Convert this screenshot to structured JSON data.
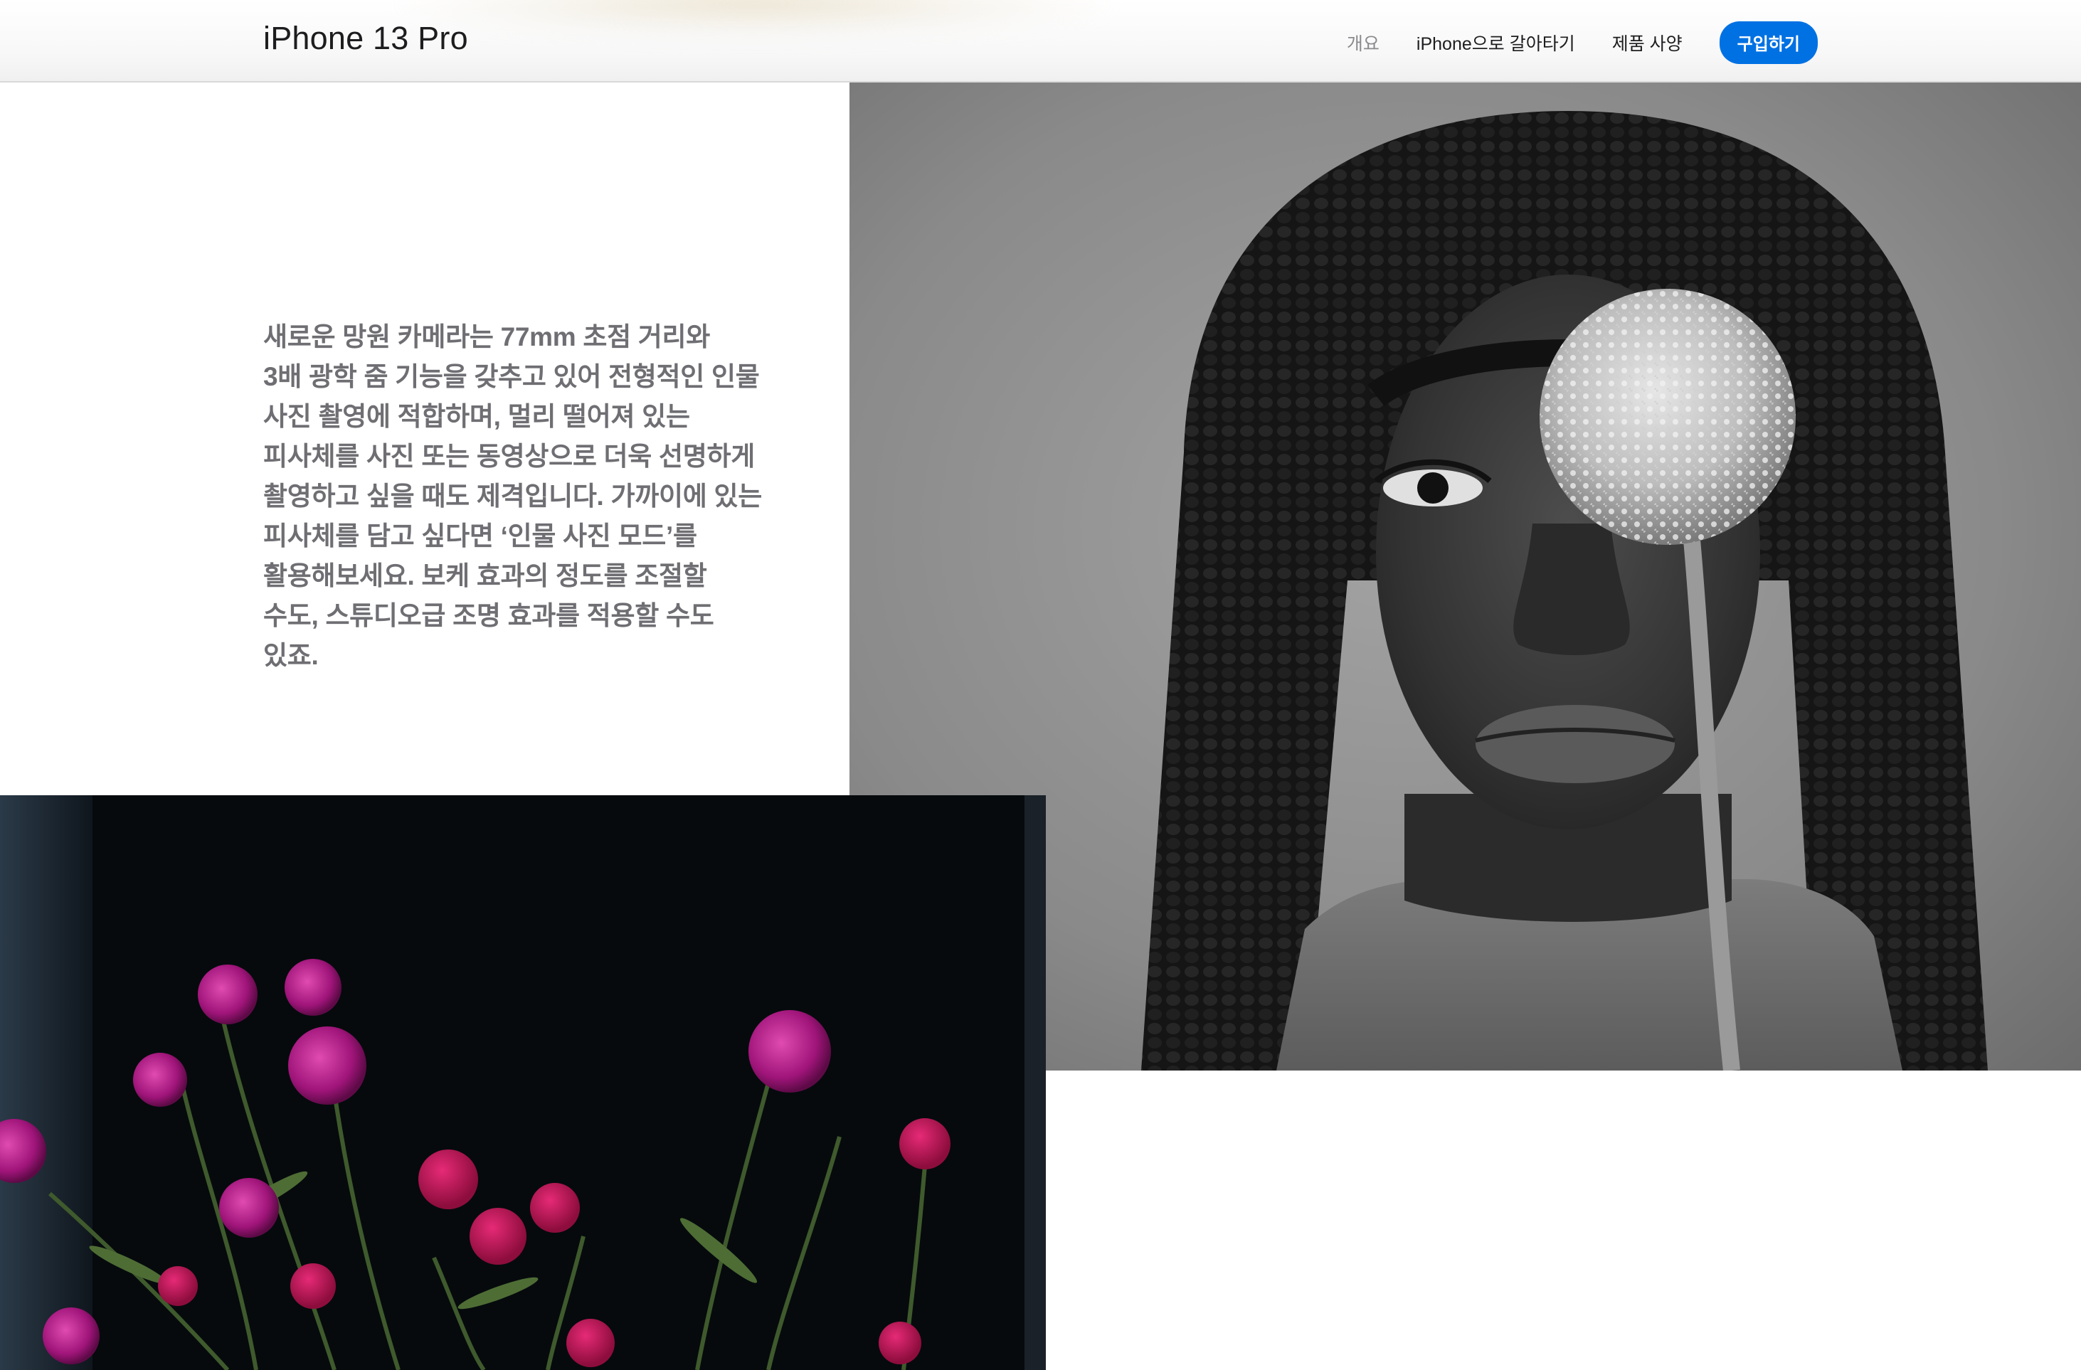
{
  "nav": {
    "title": "iPhone 13 Pro",
    "links": [
      {
        "label": "개요",
        "current": true
      },
      {
        "label": "iPhone으로 갈아타기",
        "current": false
      },
      {
        "label": "제품 사양",
        "current": false
      }
    ],
    "buy_label": "구입하기",
    "accent_color": "#0071e3"
  },
  "main": {
    "copy_lines": [
      "새로운 망원 카메라는 77mm 초점 거리와",
      "3배 광학 줌 기능을 갖추고 있어 전형적인 인물",
      "사진 촬영에 적합하며, 멀리 떨어져 있는",
      "피사체를 사진 또는 동영상으로 더욱 선명하게",
      "촬영하고 싶을 때도 제격입니다. 가까이에 있는",
      "피사체를 담고 싶다면 ‘인물 사진 모드’를",
      "활용해보세요. 보케 효과의 정도를 조절할",
      "수도, 스튜디오급 조명 효과를 적용할 수도",
      "있죠."
    ]
  },
  "images": {
    "portrait": "black-and-white portrait of a woman with braids holding an allium flower over one eye",
    "flowers": "magenta carnations and globe amaranth flowers on a dark background"
  }
}
